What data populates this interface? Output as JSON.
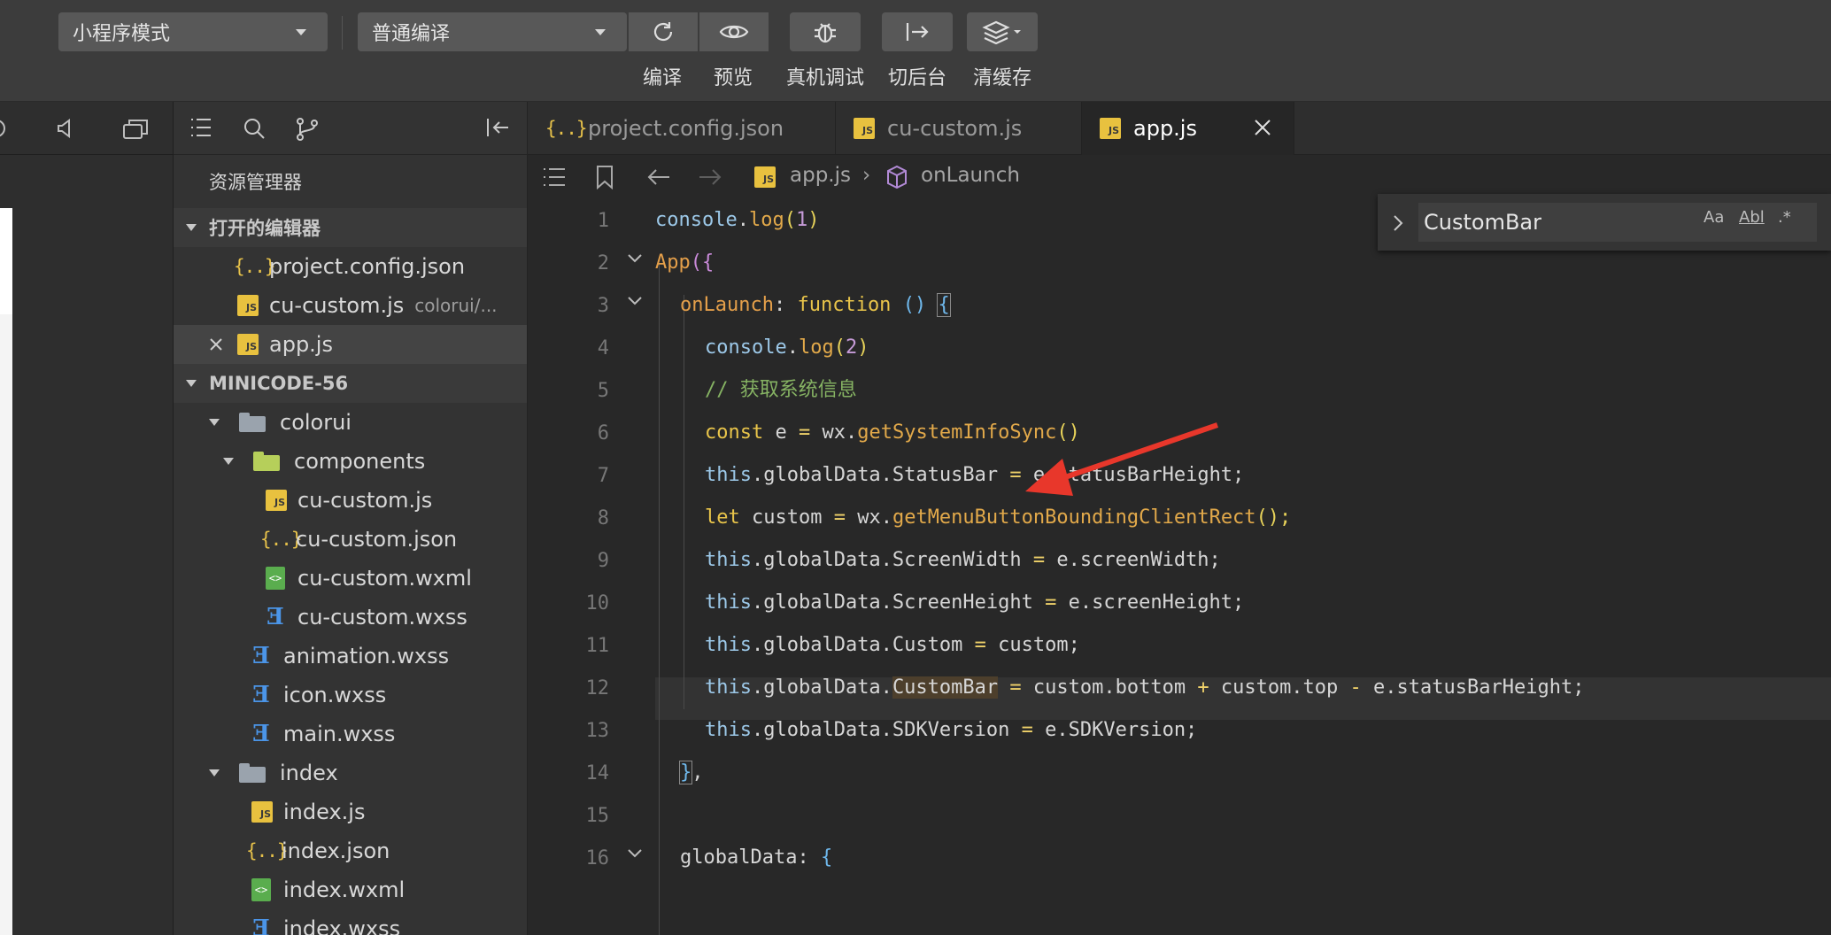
{
  "toolbar": {
    "mode_select": "小程序模式",
    "compile_select": "普通编译",
    "buttons": {
      "compile": "编译",
      "preview": "预览",
      "remote_debug": "真机调试",
      "background": "切后台",
      "clear_cache": "清缓存"
    }
  },
  "explorer": {
    "title": "资源管理器",
    "open_editors_header": "打开的编辑器",
    "open_editors": [
      {
        "name": "project.config.json"
      },
      {
        "name": "cu-custom.js",
        "path": "colorui/..."
      },
      {
        "name": "app.js"
      }
    ],
    "project_header": "MINICODE-56",
    "tree": [
      {
        "name": "colorui"
      },
      {
        "name": "components"
      },
      {
        "name": "cu-custom.js"
      },
      {
        "name": "cu-custom.json"
      },
      {
        "name": "cu-custom.wxml"
      },
      {
        "name": "cu-custom.wxss"
      },
      {
        "name": "animation.wxss"
      },
      {
        "name": "icon.wxss"
      },
      {
        "name": "main.wxss"
      },
      {
        "name": "index"
      },
      {
        "name": "index.js"
      },
      {
        "name": "index.json"
      },
      {
        "name": "index.wxml"
      },
      {
        "name": "index.wxss"
      }
    ]
  },
  "editor": {
    "tabs": [
      {
        "label": "project.config.json"
      },
      {
        "label": "cu-custom.js"
      },
      {
        "label": "app.js"
      }
    ],
    "breadcrumb": {
      "file": "app.js",
      "symbol": "onLaunch"
    },
    "find": {
      "value": "CustomBar",
      "case_option": "Aa",
      "word_option": "Abl",
      "regex_option": ".*"
    },
    "line_numbers": [
      "1",
      "2",
      "3",
      "4",
      "5",
      "6",
      "7",
      "8",
      "9",
      "10",
      "11",
      "12",
      "13",
      "14",
      "15",
      "16"
    ],
    "code": {
      "l1": {
        "a": "console",
        "b": ".",
        "c": "log",
        "d": "(",
        "e": "1",
        "f": ")"
      },
      "l2": {
        "a": "App",
        "b": "({"
      },
      "l3": {
        "a": "onLaunch",
        "b": ": ",
        "c": "function",
        "d": " ",
        "e": "()",
        "f": " ",
        "g": "{"
      },
      "l4": {
        "a": "console",
        "b": ".",
        "c": "log",
        "d": "(",
        "e": "2",
        "f": ")"
      },
      "l5": {
        "a": "// 获取系统信息"
      },
      "l6": {
        "a": "const",
        "b": " e ",
        "c": "=",
        "d": " wx.",
        "e": "getSystemInfoSync",
        "f": "()"
      },
      "l7": {
        "a": "this",
        "b": ".globalData.StatusBar ",
        "c": "=",
        "d": " e.statusBarHeight;"
      },
      "l8": {
        "a": "let",
        "b": " custom ",
        "c": "=",
        "d": " wx.",
        "e": "getMenuButtonBoundingClientRect",
        "f": "();"
      },
      "l9": {
        "a": "this",
        "b": ".globalData.ScreenWidth ",
        "c": "=",
        "d": " e.screenWidth;"
      },
      "l10": {
        "a": "this",
        "b": ".globalData.ScreenHeight ",
        "c": "=",
        "d": " e.screenHeight;"
      },
      "l11": {
        "a": "this",
        "b": ".globalData.Custom ",
        "c": "=",
        "d": " custom;"
      },
      "l12": {
        "a": "this",
        "b": ".globalData.",
        "c": "CustomBar",
        "d": " ",
        "e": "=",
        "f": " custom.bottom ",
        "g": "+",
        "h": " custom.top ",
        "i": "-",
        "j": " e.statusBarHeight;"
      },
      "l13": {
        "a": "this",
        "b": ".globalData.SDKVersion ",
        "c": "=",
        "d": " e.SDKVersion;"
      },
      "l14": {
        "a": "}",
        "b": ","
      },
      "l16": {
        "a": "globalData",
        "b": ": ",
        "c": "{"
      }
    }
  },
  "colors": {
    "annotation_arrow": "#e8372b",
    "js_icon": "#e8c13f",
    "css_icon": "#4b95e8",
    "wxml_icon": "#5aad4e"
  }
}
